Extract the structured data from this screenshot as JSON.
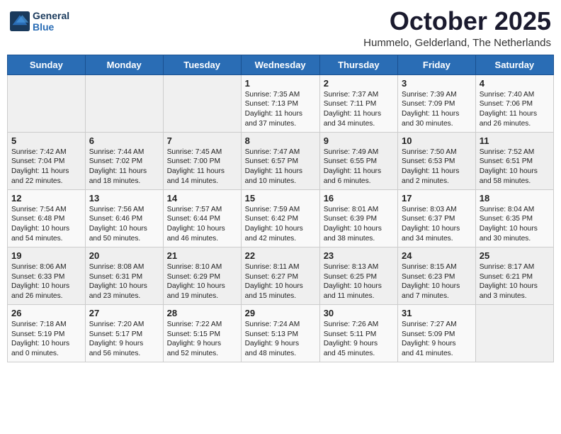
{
  "logo": {
    "line1": "General",
    "line2": "Blue"
  },
  "title": "October 2025",
  "subtitle": "Hummelo, Gelderland, The Netherlands",
  "weekdays": [
    "Sunday",
    "Monday",
    "Tuesday",
    "Wednesday",
    "Thursday",
    "Friday",
    "Saturday"
  ],
  "weeks": [
    [
      {
        "day": "",
        "info": ""
      },
      {
        "day": "",
        "info": ""
      },
      {
        "day": "",
        "info": ""
      },
      {
        "day": "1",
        "info": "Sunrise: 7:35 AM\nSunset: 7:13 PM\nDaylight: 11 hours\nand 37 minutes."
      },
      {
        "day": "2",
        "info": "Sunrise: 7:37 AM\nSunset: 7:11 PM\nDaylight: 11 hours\nand 34 minutes."
      },
      {
        "day": "3",
        "info": "Sunrise: 7:39 AM\nSunset: 7:09 PM\nDaylight: 11 hours\nand 30 minutes."
      },
      {
        "day": "4",
        "info": "Sunrise: 7:40 AM\nSunset: 7:06 PM\nDaylight: 11 hours\nand 26 minutes."
      }
    ],
    [
      {
        "day": "5",
        "info": "Sunrise: 7:42 AM\nSunset: 7:04 PM\nDaylight: 11 hours\nand 22 minutes."
      },
      {
        "day": "6",
        "info": "Sunrise: 7:44 AM\nSunset: 7:02 PM\nDaylight: 11 hours\nand 18 minutes."
      },
      {
        "day": "7",
        "info": "Sunrise: 7:45 AM\nSunset: 7:00 PM\nDaylight: 11 hours\nand 14 minutes."
      },
      {
        "day": "8",
        "info": "Sunrise: 7:47 AM\nSunset: 6:57 PM\nDaylight: 11 hours\nand 10 minutes."
      },
      {
        "day": "9",
        "info": "Sunrise: 7:49 AM\nSunset: 6:55 PM\nDaylight: 11 hours\nand 6 minutes."
      },
      {
        "day": "10",
        "info": "Sunrise: 7:50 AM\nSunset: 6:53 PM\nDaylight: 11 hours\nand 2 minutes."
      },
      {
        "day": "11",
        "info": "Sunrise: 7:52 AM\nSunset: 6:51 PM\nDaylight: 10 hours\nand 58 minutes."
      }
    ],
    [
      {
        "day": "12",
        "info": "Sunrise: 7:54 AM\nSunset: 6:48 PM\nDaylight: 10 hours\nand 54 minutes."
      },
      {
        "day": "13",
        "info": "Sunrise: 7:56 AM\nSunset: 6:46 PM\nDaylight: 10 hours\nand 50 minutes."
      },
      {
        "day": "14",
        "info": "Sunrise: 7:57 AM\nSunset: 6:44 PM\nDaylight: 10 hours\nand 46 minutes."
      },
      {
        "day": "15",
        "info": "Sunrise: 7:59 AM\nSunset: 6:42 PM\nDaylight: 10 hours\nand 42 minutes."
      },
      {
        "day": "16",
        "info": "Sunrise: 8:01 AM\nSunset: 6:39 PM\nDaylight: 10 hours\nand 38 minutes."
      },
      {
        "day": "17",
        "info": "Sunrise: 8:03 AM\nSunset: 6:37 PM\nDaylight: 10 hours\nand 34 minutes."
      },
      {
        "day": "18",
        "info": "Sunrise: 8:04 AM\nSunset: 6:35 PM\nDaylight: 10 hours\nand 30 minutes."
      }
    ],
    [
      {
        "day": "19",
        "info": "Sunrise: 8:06 AM\nSunset: 6:33 PM\nDaylight: 10 hours\nand 26 minutes."
      },
      {
        "day": "20",
        "info": "Sunrise: 8:08 AM\nSunset: 6:31 PM\nDaylight: 10 hours\nand 23 minutes."
      },
      {
        "day": "21",
        "info": "Sunrise: 8:10 AM\nSunset: 6:29 PM\nDaylight: 10 hours\nand 19 minutes."
      },
      {
        "day": "22",
        "info": "Sunrise: 8:11 AM\nSunset: 6:27 PM\nDaylight: 10 hours\nand 15 minutes."
      },
      {
        "day": "23",
        "info": "Sunrise: 8:13 AM\nSunset: 6:25 PM\nDaylight: 10 hours\nand 11 minutes."
      },
      {
        "day": "24",
        "info": "Sunrise: 8:15 AM\nSunset: 6:23 PM\nDaylight: 10 hours\nand 7 minutes."
      },
      {
        "day": "25",
        "info": "Sunrise: 8:17 AM\nSunset: 6:21 PM\nDaylight: 10 hours\nand 3 minutes."
      }
    ],
    [
      {
        "day": "26",
        "info": "Sunrise: 7:18 AM\nSunset: 5:19 PM\nDaylight: 10 hours\nand 0 minutes."
      },
      {
        "day": "27",
        "info": "Sunrise: 7:20 AM\nSunset: 5:17 PM\nDaylight: 9 hours\nand 56 minutes."
      },
      {
        "day": "28",
        "info": "Sunrise: 7:22 AM\nSunset: 5:15 PM\nDaylight: 9 hours\nand 52 minutes."
      },
      {
        "day": "29",
        "info": "Sunrise: 7:24 AM\nSunset: 5:13 PM\nDaylight: 9 hours\nand 48 minutes."
      },
      {
        "day": "30",
        "info": "Sunrise: 7:26 AM\nSunset: 5:11 PM\nDaylight: 9 hours\nand 45 minutes."
      },
      {
        "day": "31",
        "info": "Sunrise: 7:27 AM\nSunset: 5:09 PM\nDaylight: 9 hours\nand 41 minutes."
      },
      {
        "day": "",
        "info": ""
      }
    ]
  ]
}
